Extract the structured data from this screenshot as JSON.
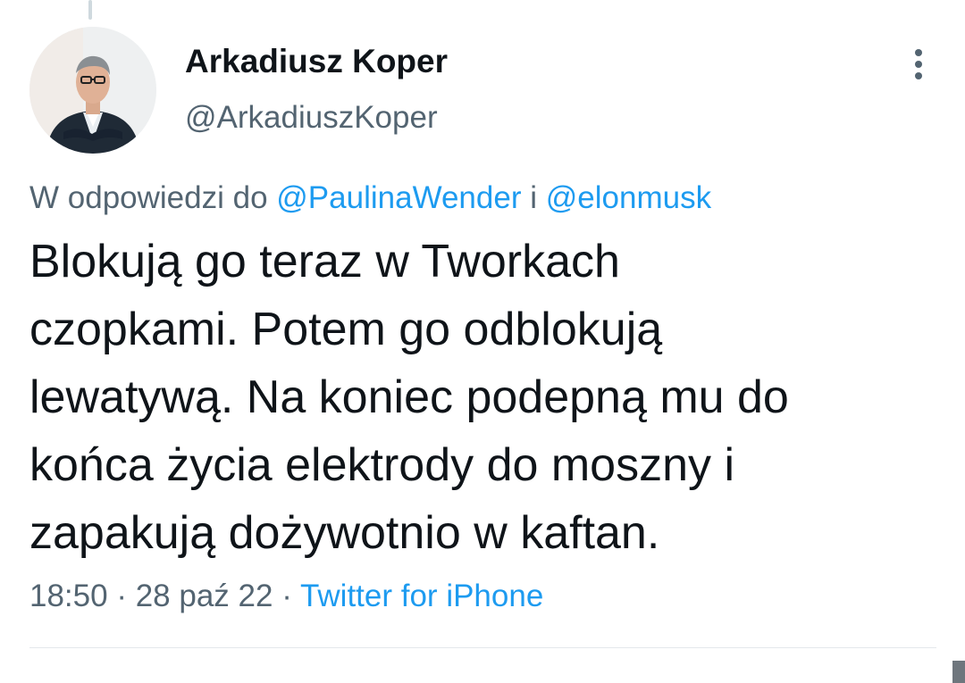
{
  "author": {
    "display_name": "Arkadiusz Koper",
    "handle": "@ArkadiuszKoper",
    "avatar_icon": "profile-photo"
  },
  "more_icon": "more-vertical-icon",
  "reply_context": {
    "prefix": "W odpowiedzi do",
    "mention_1": "@PaulinaWender",
    "conjunction": "i",
    "mention_2": "@elonmusk"
  },
  "tweet": {
    "lines": [
      "Blokują go teraz w Tworkach",
      "czopkami. Potem go odblokują",
      "lewatywą. Na koniec podepną mu do",
      "końca życia elektrody do moszny i",
      "zapakują dożywotnio w kaftan."
    ]
  },
  "meta": {
    "time": "18:50",
    "separator": "·",
    "date": "28 paź 22",
    "source": "Twitter for iPhone"
  },
  "colors": {
    "link": "#1d9bf0",
    "secondary_text": "#536471",
    "primary_text": "#0f1419"
  }
}
